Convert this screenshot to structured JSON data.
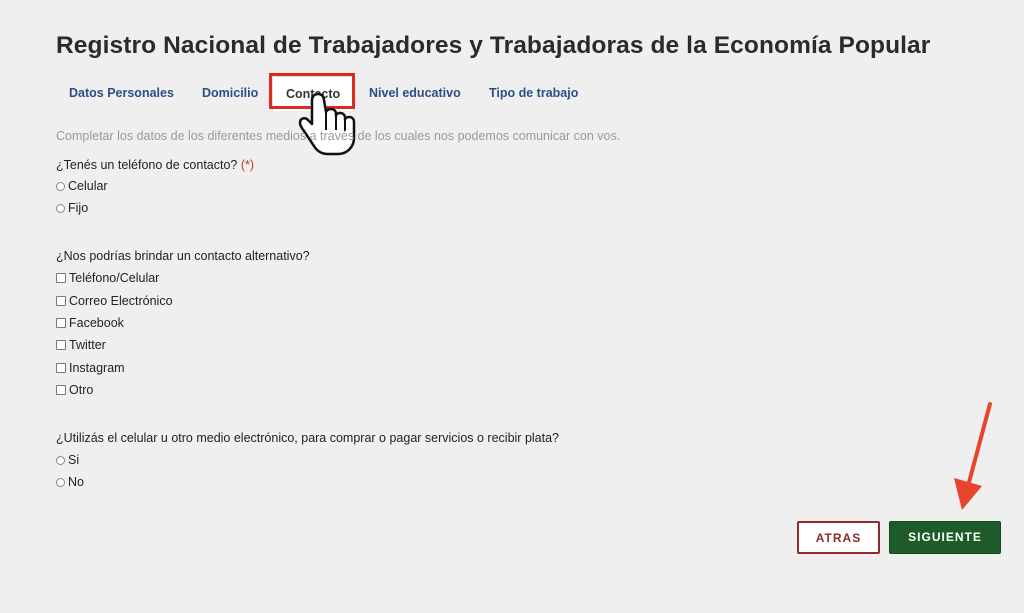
{
  "page": {
    "title": "Registro Nacional de Trabajadores y Trabajadoras de la Economía Popular"
  },
  "tabs": [
    {
      "label": "Datos Personales"
    },
    {
      "label": "Domicilio"
    },
    {
      "label": "Contacto",
      "active": true
    },
    {
      "label": "Nivel educativo"
    },
    {
      "label": "Tipo de trabajo"
    }
  ],
  "form": {
    "intro": "Completar los datos de los diferentes medios a través de los cuales nos podemos comunicar con vos.",
    "phone_question": "¿Tenés un teléfono de contacto?",
    "required_mark": "(*)",
    "phone_options": [
      "Celular",
      "Fijo"
    ],
    "alt_contact_question": "¿Nos podrías brindar un contacto alternativo?",
    "alt_contact_options": [
      "Teléfono/Celular",
      "Correo Electrónico",
      "Facebook",
      "Twitter",
      "Instagram",
      "Otro"
    ],
    "electronic_question": "¿Utilizás el celular u otro medio electrónico, para comprar o pagar servicios o recibir plata?",
    "electronic_options": [
      "Si",
      "No"
    ]
  },
  "buttons": {
    "back_label": "ATRAS",
    "next_label": "SIGUIENTE"
  },
  "annotations": {
    "highlight_color": "#e02a1f",
    "arrow_color": "#e8432b"
  },
  "colors": {
    "link": "#2d4f86",
    "back": "#8e2b2b",
    "next": "#1f5a2a"
  }
}
